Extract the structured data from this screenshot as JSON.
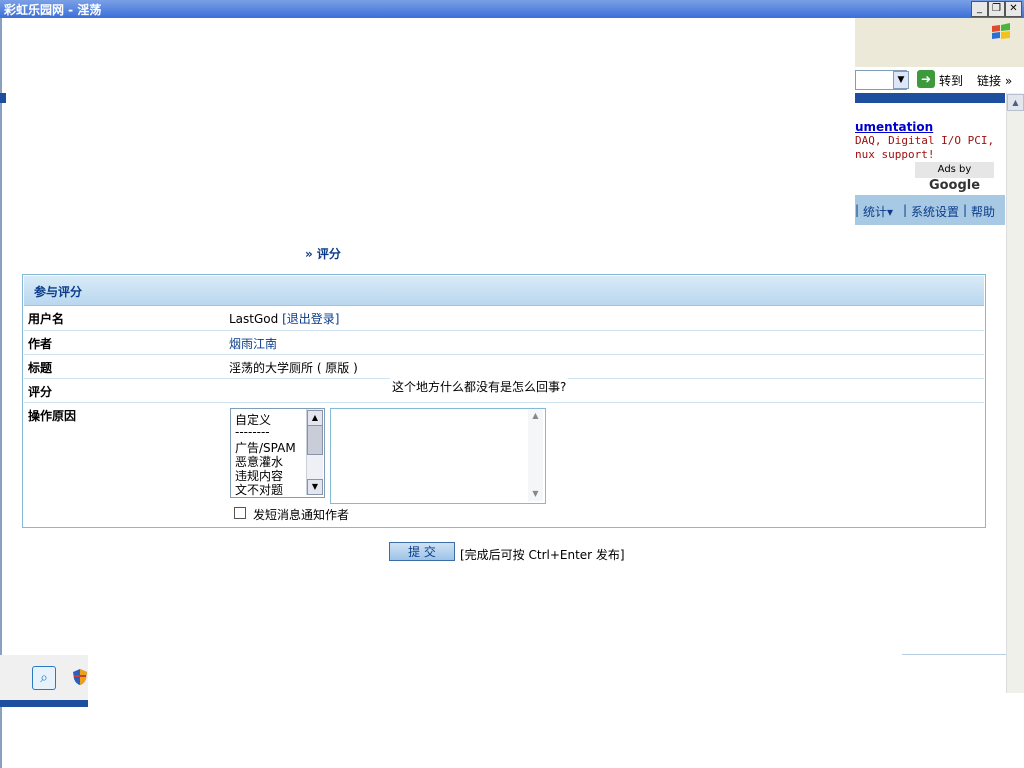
{
  "window": {
    "title": "彩虹乐园网 - 淫荡"
  },
  "toolbar": {
    "go_label": "转到",
    "links_label": "链接 »"
  },
  "ad": {
    "title": "umentation",
    "line1": "DAQ, Digital I/O PCI,",
    "line2": "nux support!",
    "ads_by": "Ads by",
    "google": "Google"
  },
  "nav": {
    "stats": "统计▾",
    "settings": "系统设置",
    "help": "帮助"
  },
  "breadcrumb": "» 评分",
  "form": {
    "header": "参与评分",
    "rows": {
      "username_label": "用户名",
      "username_value": "LastGod",
      "logout_link": "[退出登录]",
      "author_label": "作者",
      "author_value": "烟雨江南",
      "subject_label": "标题",
      "subject_value": "淫荡的大学厕所 ( 原版 )",
      "rating_label": "评分",
      "rating_note": "这个地方什么都没有是怎么回事?",
      "reason_label": "操作原因"
    },
    "reason_options": [
      "自定义",
      "--------",
      "广告/SPAM",
      "恶意灌水",
      "违规内容",
      "文不对题"
    ],
    "notify_label": "发短消息通知作者",
    "notify_checked": false
  },
  "submit": {
    "label": "提  交",
    "hint": "[完成后可按 Ctrl+Enter 发布]"
  }
}
